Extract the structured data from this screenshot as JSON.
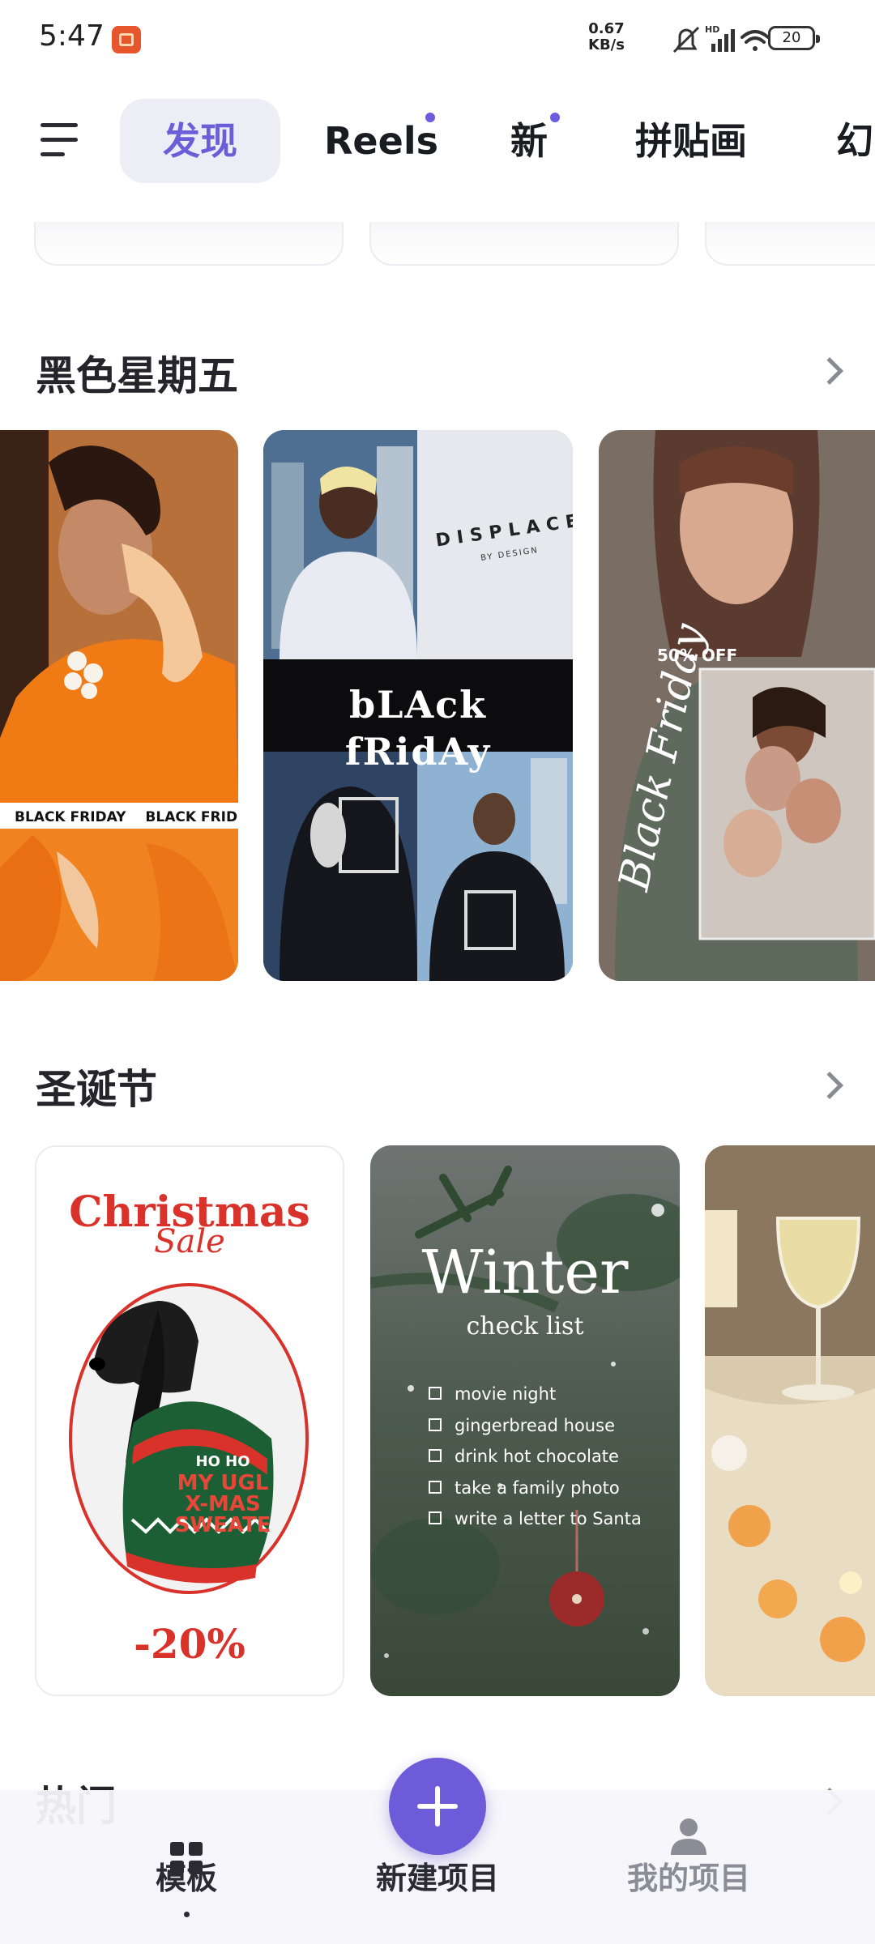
{
  "status_bar": {
    "time": "5:47",
    "speed_value": "0.67",
    "speed_unit": "KB/s",
    "hd_label": "HD",
    "battery": "20"
  },
  "tabs": [
    {
      "label": "发现",
      "active": true
    },
    {
      "label": "Reels",
      "dot": true
    },
    {
      "label": "新",
      "dot": true
    },
    {
      "label": "拼贴画"
    },
    {
      "label": "幻"
    }
  ],
  "sections": {
    "black_friday": {
      "title": "黑色星期五",
      "card1_banner": [
        "BLACK FRIDAY",
        "BLACK FRID"
      ],
      "card2_brand": "DISPLACES",
      "card2_brand_sub": "BY DESIGN",
      "card2_banner": "bLAck fRidAy",
      "card3_discount": "50% OFF",
      "card3_script": "Black Friday"
    },
    "christmas": {
      "title": "圣诞节",
      "card1_title": "Christmas",
      "card1_script": "Sale",
      "card1_sweater": [
        "HO HO",
        "MY UGL",
        "X-MAS",
        "SWEATE"
      ],
      "card1_discount": "-20%",
      "card2_title": "Winter",
      "card2_subtitle": "check list",
      "card2_items": [
        "movie night",
        "gingerbread house",
        "drink hot chocolate",
        "take a family photo",
        "write a letter to Santa"
      ]
    },
    "hot": {
      "title": "热门"
    }
  },
  "bottom_nav": {
    "templates": "模板",
    "new_project": "新建项目",
    "my_projects": "我的项目"
  },
  "colors": {
    "accent": "#6e5bd9",
    "active_tab_bg": "#ededf6",
    "christmas_red": "#d8322a"
  }
}
